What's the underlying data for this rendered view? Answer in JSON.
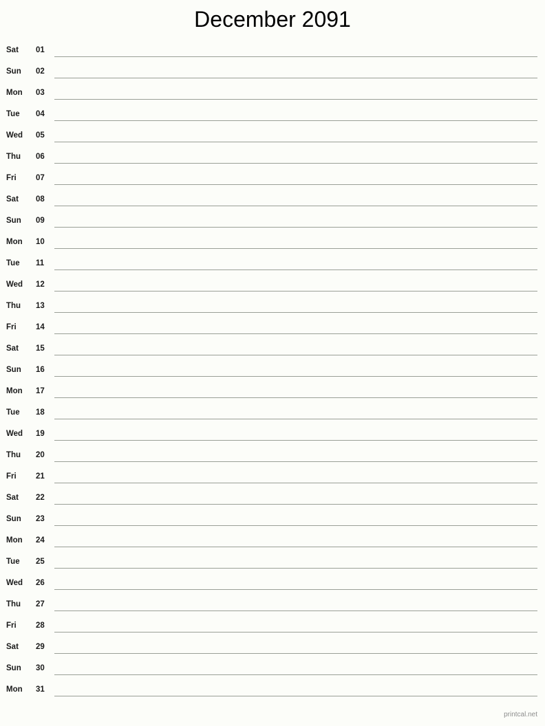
{
  "document": {
    "title": "December 2091",
    "month": "December",
    "year": "2091",
    "layout": "single-column-notes",
    "colors": {
      "background": "#fcfdf9",
      "text": "#1a1a1a",
      "title_text": "#000000",
      "rule_line": "#9a9f96",
      "footer_text": "#8d8d8d"
    }
  },
  "footer": {
    "credit": "printcal.net"
  },
  "days": [
    {
      "weekday": "Sat",
      "number": "01"
    },
    {
      "weekday": "Sun",
      "number": "02"
    },
    {
      "weekday": "Mon",
      "number": "03"
    },
    {
      "weekday": "Tue",
      "number": "04"
    },
    {
      "weekday": "Wed",
      "number": "05"
    },
    {
      "weekday": "Thu",
      "number": "06"
    },
    {
      "weekday": "Fri",
      "number": "07"
    },
    {
      "weekday": "Sat",
      "number": "08"
    },
    {
      "weekday": "Sun",
      "number": "09"
    },
    {
      "weekday": "Mon",
      "number": "10"
    },
    {
      "weekday": "Tue",
      "number": "11"
    },
    {
      "weekday": "Wed",
      "number": "12"
    },
    {
      "weekday": "Thu",
      "number": "13"
    },
    {
      "weekday": "Fri",
      "number": "14"
    },
    {
      "weekday": "Sat",
      "number": "15"
    },
    {
      "weekday": "Sun",
      "number": "16"
    },
    {
      "weekday": "Mon",
      "number": "17"
    },
    {
      "weekday": "Tue",
      "number": "18"
    },
    {
      "weekday": "Wed",
      "number": "19"
    },
    {
      "weekday": "Thu",
      "number": "20"
    },
    {
      "weekday": "Fri",
      "number": "21"
    },
    {
      "weekday": "Sat",
      "number": "22"
    },
    {
      "weekday": "Sun",
      "number": "23"
    },
    {
      "weekday": "Mon",
      "number": "24"
    },
    {
      "weekday": "Tue",
      "number": "25"
    },
    {
      "weekday": "Wed",
      "number": "26"
    },
    {
      "weekday": "Thu",
      "number": "27"
    },
    {
      "weekday": "Fri",
      "number": "28"
    },
    {
      "weekday": "Sat",
      "number": "29"
    },
    {
      "weekday": "Sun",
      "number": "30"
    },
    {
      "weekday": "Mon",
      "number": "31"
    }
  ]
}
